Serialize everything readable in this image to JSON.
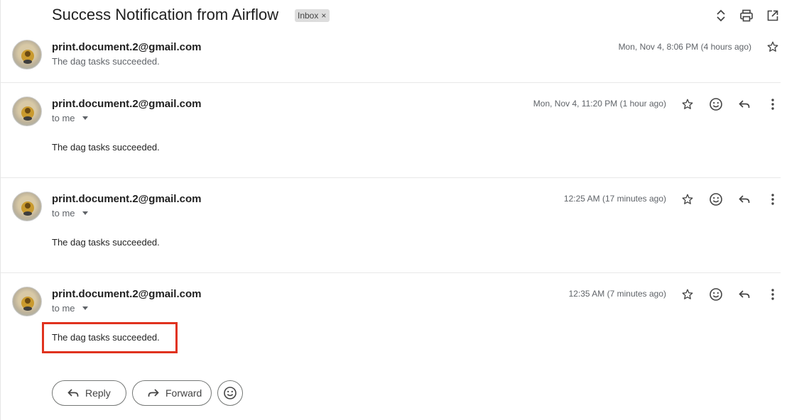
{
  "thread": {
    "subject": "Success Notification from Airflow",
    "label": "Inbox",
    "label_remove": "×"
  },
  "messages": [
    {
      "sender": "print.document.2@gmail.com",
      "snippet": "The dag tasks succeeded.",
      "date": "Mon, Nov 4, 8:06 PM (4 hours ago)",
      "collapsed": true
    },
    {
      "sender": "print.document.2@gmail.com",
      "recipient": "to me",
      "date": "Mon, Nov 4, 11:20 PM (1 hour ago)",
      "body": "The dag tasks succeeded."
    },
    {
      "sender": "print.document.2@gmail.com",
      "recipient": "to me",
      "date": "12:25 AM (17 minutes ago)",
      "body": "The dag tasks succeeded."
    },
    {
      "sender": "print.document.2@gmail.com",
      "recipient": "to me",
      "date": "12:35 AM (7 minutes ago)",
      "body": "The dag tasks succeeded."
    }
  ],
  "actions": {
    "reply_label": "Reply",
    "forward_label": "Forward"
  },
  "icons": {
    "expand": "unfold-icon",
    "print": "print-icon",
    "open_new": "open-in-new-window-icon",
    "star": "star-icon",
    "emoji": "emoji-icon",
    "reply": "reply-icon",
    "more": "more-vert-icon"
  },
  "colors": {
    "highlight": "#e0321e",
    "secondary_text": "#5f6368",
    "chip_bg": "#dddddd"
  }
}
